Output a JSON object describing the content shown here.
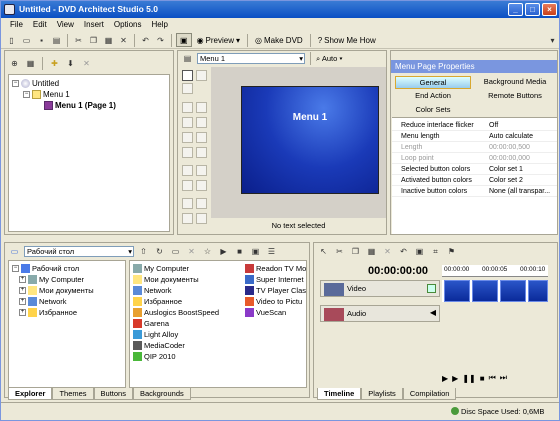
{
  "window": {
    "title": "Untitled - DVD Architect Studio 5.0"
  },
  "menubar": {
    "items": [
      "File",
      "Edit",
      "View",
      "Insert",
      "Options",
      "Help"
    ]
  },
  "toolbar": {
    "preview_label": "Preview",
    "make_dvd_label": "Make DVD",
    "show_me_how_label": "Show Me How"
  },
  "project_tree": {
    "root": "Untitled",
    "menu": "Menu 1",
    "page": "Menu 1 (Page 1)"
  },
  "center": {
    "menu_select": "Menu 1",
    "zoom": "Auto",
    "canvas_title": "Menu 1",
    "status": "No text selected"
  },
  "properties": {
    "header": "Menu Page Properties",
    "tabs": [
      "General",
      "Background Media",
      "End Action",
      "Remote Buttons",
      "Color Sets"
    ],
    "rows": [
      {
        "k": "Reduce interlace flicker",
        "v": "Off",
        "disabled": false
      },
      {
        "k": "Menu length",
        "v": "Auto calculate",
        "disabled": false
      },
      {
        "k": "Length",
        "v": "00:00:00,500",
        "disabled": true
      },
      {
        "k": "Loop point",
        "v": "00:00:00,000",
        "disabled": true
      },
      {
        "k": "Selected button colors",
        "v": "Color set 1",
        "disabled": false
      },
      {
        "k": "Activated button colors",
        "v": "Color set 2",
        "disabled": false
      },
      {
        "k": "Inactive button colors",
        "v": "None (all transpar...",
        "disabled": false
      }
    ]
  },
  "explorer": {
    "location": "Рабочий стол",
    "tree": [
      "Рабочий стол",
      "My Computer",
      "Мои документы",
      "Network",
      "Избранное"
    ],
    "files_col1": [
      "My Computer",
      "Мои документы",
      "Network",
      "Избранное",
      "Auslogics BoostSpeed",
      "Garena",
      "Light Alloy",
      "MediaCoder",
      "QIP 2010"
    ],
    "files_col2": [
      "Readon TV Mo",
      "Super Internet",
      "TV Player Clas",
      "Video to Pictu",
      "VueScan"
    ],
    "tabs": [
      "Explorer",
      "Themes",
      "Buttons",
      "Backgrounds"
    ]
  },
  "timeline": {
    "timecode": "00:00:00:00",
    "ruler": [
      "00:00:00",
      "00:00:05",
      "00:00:10"
    ],
    "tracks": [
      "Video",
      "Audio"
    ],
    "tabs": [
      "Timeline",
      "Playlists",
      "Compilation"
    ]
  },
  "statusbar": {
    "disc": "Disc Space Used: 0,6MB"
  }
}
